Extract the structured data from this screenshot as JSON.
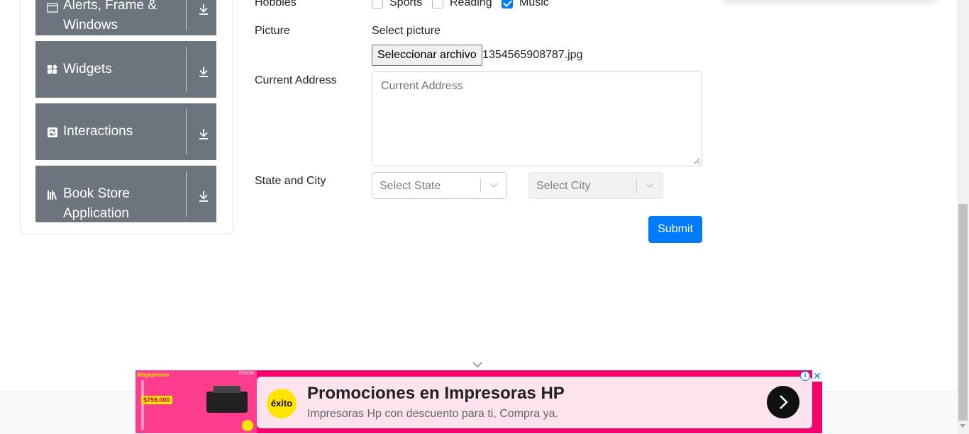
{
  "sidebar": {
    "groups": [
      {
        "label": "Alerts, Frame & Windows",
        "icon": "window-icon"
      },
      {
        "label": "Widgets",
        "icon": "widgets-icon"
      },
      {
        "label": "Interactions",
        "icon": "interactions-icon"
      },
      {
        "label": "Book Store Application",
        "icon": "book-store-icon"
      }
    ]
  },
  "form": {
    "hobbies": {
      "label": "Hobbies",
      "options": [
        {
          "label": "Sports",
          "checked": false
        },
        {
          "label": "Reading",
          "checked": false
        },
        {
          "label": "Music",
          "checked": true
        }
      ]
    },
    "picture": {
      "label": "Picture",
      "select_text": "Select picture",
      "button_label": "Seleccionar archivo",
      "file_name": "1354565908787.jpg"
    },
    "address": {
      "label": "Current Address",
      "placeholder": "Current Address"
    },
    "state_city": {
      "label": "State and City",
      "state_placeholder": "Select State",
      "city_placeholder": "Select City"
    },
    "submit_label": "Submit"
  },
  "ad": {
    "title": "Promociones en Impresoras HP",
    "description": "Impresoras Hp con descuento para ti, Compra ya.",
    "logo_text": "éxito",
    "image_brand": "Megapromo",
    "image_price": "$759.000",
    "image_brand_epson": "EPSON",
    "info_symbol": "i",
    "close_symbol": "✕"
  },
  "colors": {
    "primary": "#007bff",
    "sidebar_group": "#6c757d",
    "ad_background": "#f7006b"
  }
}
